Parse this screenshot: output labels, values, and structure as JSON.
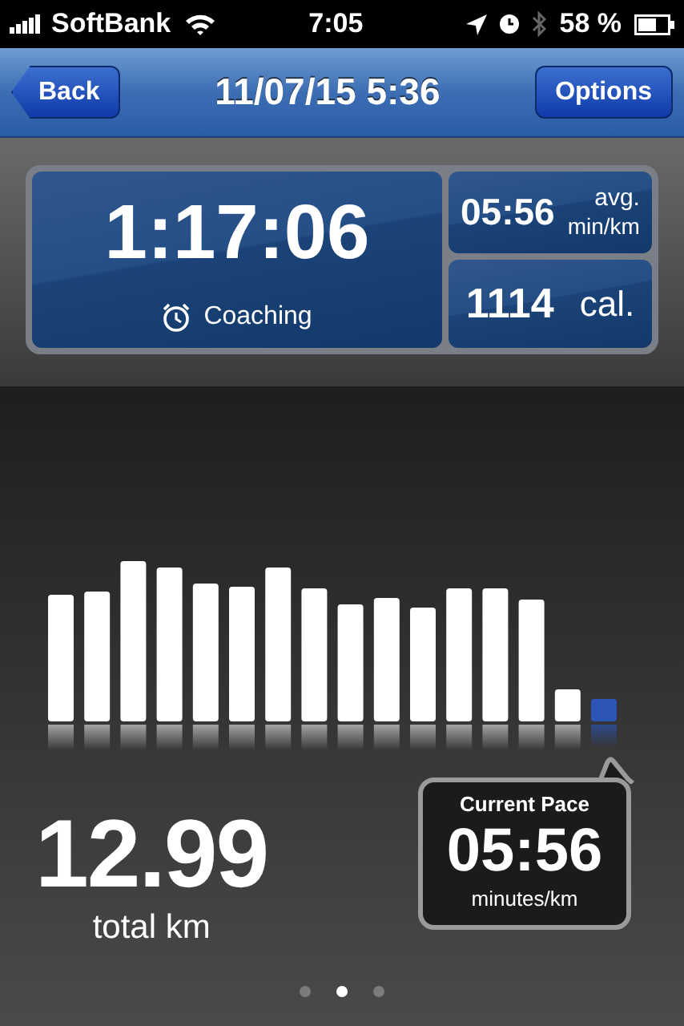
{
  "status_bar": {
    "carrier": "SoftBank",
    "time": "7:05",
    "battery": "58 %"
  },
  "nav_bar": {
    "back": "Back",
    "title": "11/07/15 5:36",
    "options": "Options"
  },
  "summary": {
    "duration": "1:17:06",
    "coaching": "Coaching",
    "pace": "05:56",
    "pace_unit_top": "avg.",
    "pace_unit_bottom": "min/km",
    "calories": "1114",
    "calories_unit": "cal."
  },
  "distance": {
    "value": "12.99",
    "label": "total km"
  },
  "current_pace": {
    "title": "Current Pace",
    "value": "05:56",
    "unit": "minutes/km"
  },
  "pages": [
    {
      "selected": false
    },
    {
      "selected": true
    },
    {
      "selected": false
    }
  ]
}
